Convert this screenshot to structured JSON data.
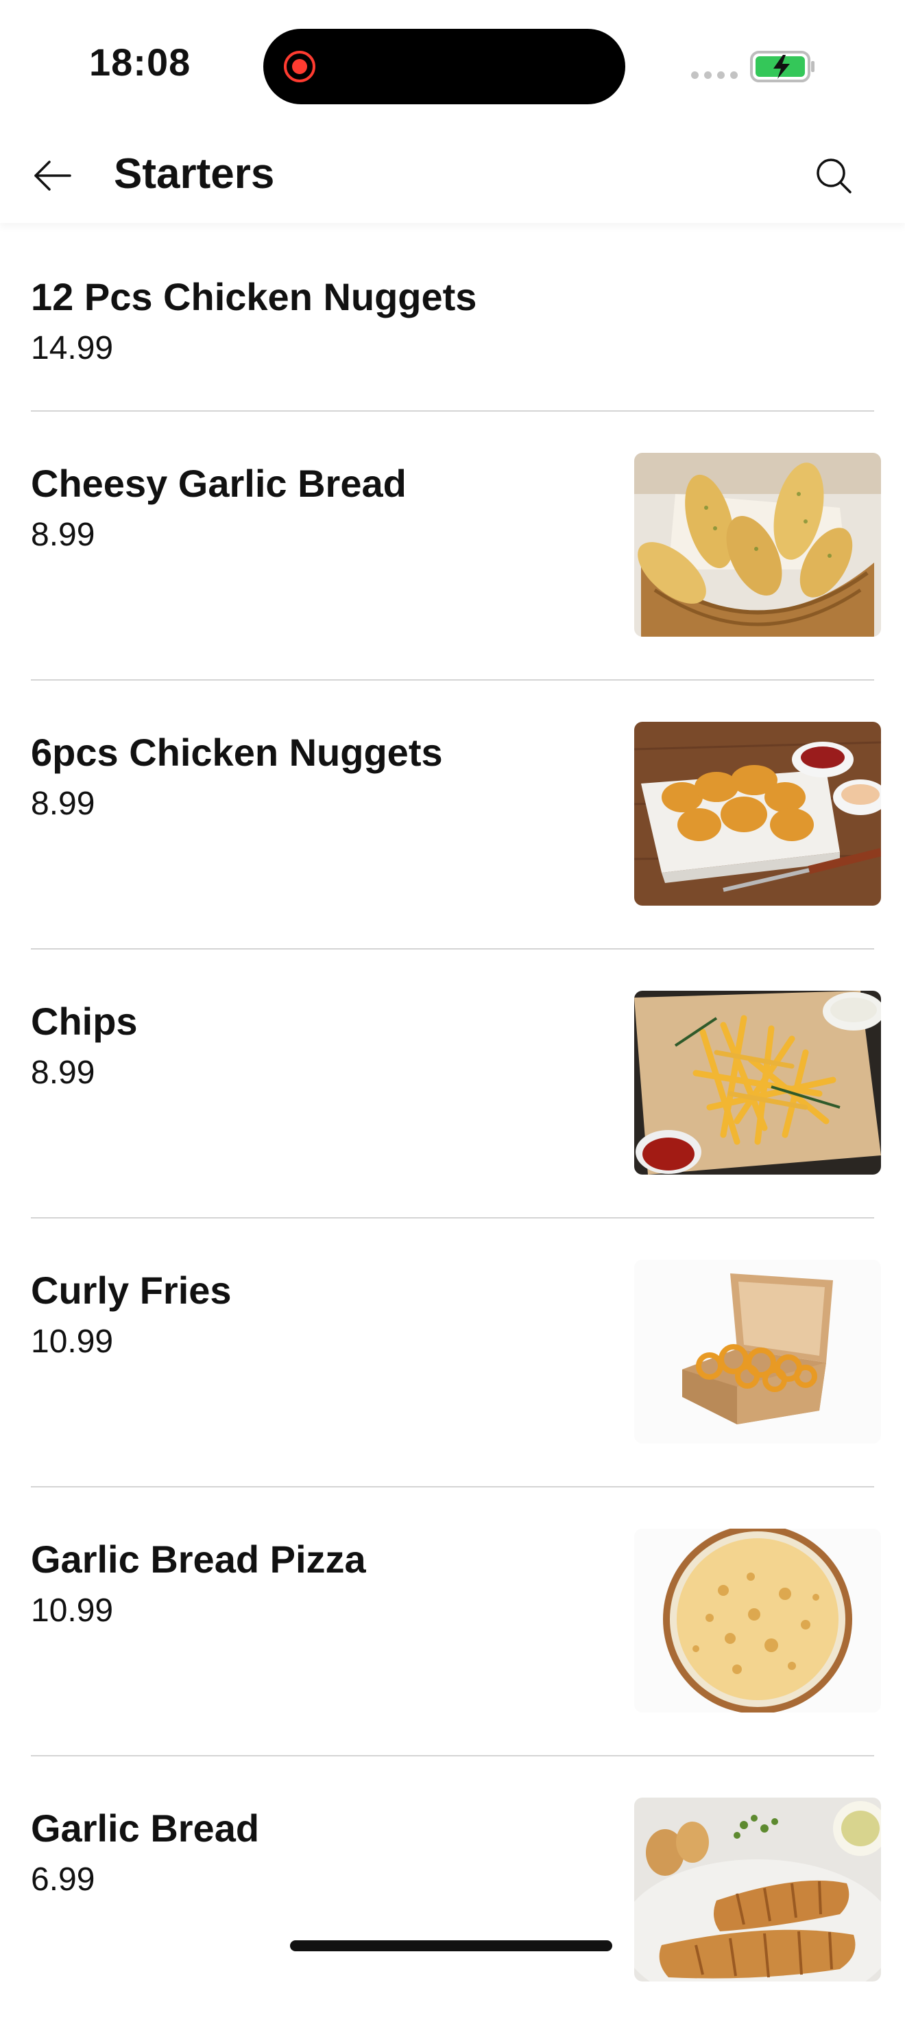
{
  "status_bar": {
    "time": "18:08",
    "icons": [
      "screen-recording-icon",
      "cellular-signal-icon",
      "battery-charging-icon"
    ],
    "colors": {
      "recording": "#ff3b30",
      "battery_fill": "#34c759"
    }
  },
  "header": {
    "title": "Starters",
    "back_icon": "arrow-left-icon",
    "search_icon": "search-icon"
  },
  "menu": {
    "items": [
      {
        "name": "12 Pcs Chicken Nuggets",
        "price": "14.99",
        "image": "none"
      },
      {
        "name": "Cheesy Garlic Bread",
        "price": "8.99",
        "image": "garlic-bread-basket-photo"
      },
      {
        "name": "6pcs Chicken Nuggets",
        "price": "8.99",
        "image": "chicken-nuggets-photo"
      },
      {
        "name": "Chips",
        "price": "8.99",
        "image": "chips-photo"
      },
      {
        "name": "Curly Fries",
        "price": "10.99",
        "image": "curly-fries-box-photo"
      },
      {
        "name": "Garlic Bread Pizza",
        "price": "10.99",
        "image": "garlic-bread-pizza-photo"
      },
      {
        "name": "Garlic Bread",
        "price": "6.99",
        "image": "garlic-bread-loaf-photo"
      }
    ]
  }
}
